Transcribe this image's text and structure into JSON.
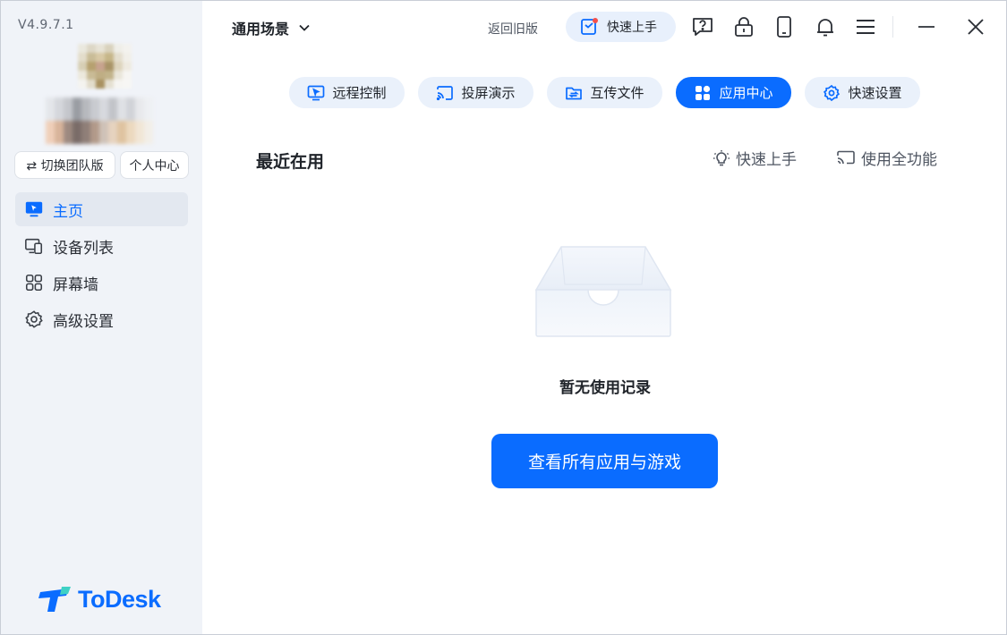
{
  "app": {
    "version": "V4.9.7.1",
    "brand_name": "ToDesk",
    "brand_color": "#0a6cff"
  },
  "sidebar": {
    "switch_team_label": "⇄ 切换团队版",
    "personal_center_label": "个人中心",
    "items": [
      {
        "label": "主页",
        "icon": "monitor-icon",
        "active": true
      },
      {
        "label": "设备列表",
        "icon": "devices-icon",
        "active": false
      },
      {
        "label": "屏幕墙",
        "icon": "grid-icon",
        "active": false
      },
      {
        "label": "高级设置",
        "icon": "gear-icon",
        "active": false
      }
    ]
  },
  "header": {
    "scene_label": "通用场景",
    "back_old_label": "返回旧版",
    "quick_start_label": "快速上手"
  },
  "tabs": [
    {
      "label": "远程控制",
      "icon": "remote-monitor-icon",
      "active": false
    },
    {
      "label": "投屏演示",
      "icon": "cast-icon",
      "active": false
    },
    {
      "label": "互传文件",
      "icon": "folder-transfer-icon",
      "active": false
    },
    {
      "label": "应用中心",
      "icon": "apps-icon",
      "active": true
    },
    {
      "label": "快速设置",
      "icon": "gear-icon",
      "active": false
    }
  ],
  "main": {
    "section_title": "最近在用",
    "quick_start_link": "快速上手",
    "full_feature_link": "使用全功能",
    "empty_text": "暂无使用记录",
    "cta_label": "查看所有应用与游戏"
  }
}
